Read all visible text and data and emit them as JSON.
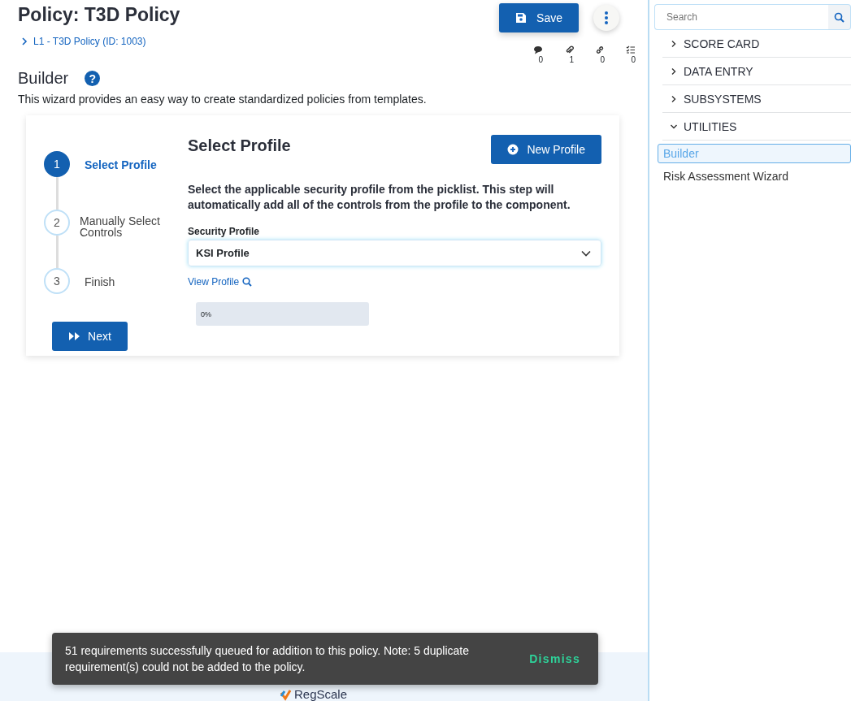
{
  "page": {
    "title": "Policy: T3D Policy",
    "breadcrumb": "L1 - T3D Policy (ID: 1003)"
  },
  "toolbar": {
    "save": "Save",
    "counts": [
      {
        "kind": "comments",
        "count": "0"
      },
      {
        "kind": "attachments",
        "count": "1"
      },
      {
        "kind": "links",
        "count": "0"
      },
      {
        "kind": "tasks",
        "count": "0"
      }
    ]
  },
  "builder": {
    "title": "Builder",
    "help": "?",
    "description": "This wizard provides an easy way to create standardized policies from templates."
  },
  "wizard": {
    "steps": [
      {
        "number": "1",
        "label": "Select Profile",
        "selected": true
      },
      {
        "number": "2",
        "label": "Manually Select Controls",
        "selected": false
      },
      {
        "number": "3",
        "label": "Finish",
        "selected": false
      }
    ],
    "next": "Next",
    "title": "Select Profile",
    "new_profile": "New Profile",
    "instructions": "Select the applicable security profile from the picklist. This step will automatically add all of the controls from the profile to the component.",
    "field_label": "Security Profile",
    "field_value": "KSI Profile",
    "view_profile": "View Profile",
    "progress": {
      "level": 0,
      "reading": "0%"
    }
  },
  "sidebar": {
    "search_placeholder": "Search",
    "sections": [
      {
        "label": "SCORE CARD",
        "expanded": false
      },
      {
        "label": "DATA ENTRY",
        "expanded": false
      },
      {
        "label": "SUBSYSTEMS",
        "expanded": false
      },
      {
        "label": "UTILITIES",
        "expanded": true,
        "items": [
          {
            "label": "Builder",
            "selected": true
          },
          {
            "label": "Risk Assessment Wizard",
            "selected": false
          }
        ]
      }
    ]
  },
  "footer": {
    "logo": "RegScale"
  },
  "snackbar": {
    "message": "51 requirements successfully queued for addition to this policy. Note: 5 duplicate requirement(s) could not be added to the policy.",
    "action": "Dismiss"
  }
}
